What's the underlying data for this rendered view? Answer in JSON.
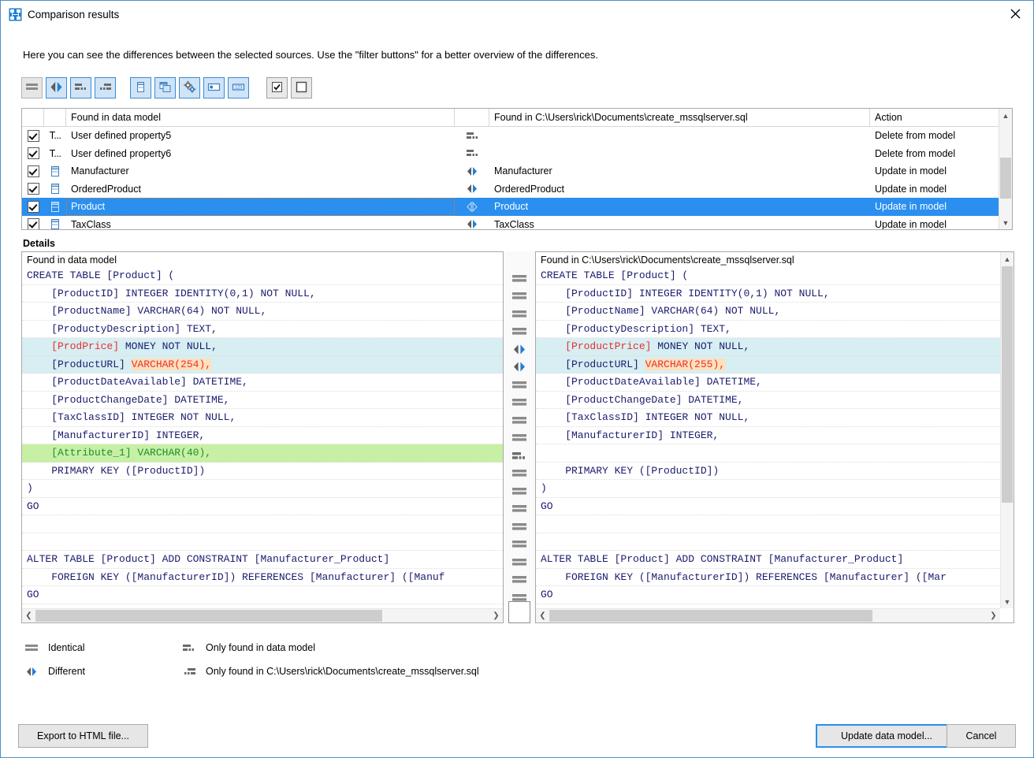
{
  "window": {
    "title": "Comparison results",
    "icon": "comparison-results-icon",
    "close_label": "✕"
  },
  "intro": {
    "text": "Here you can see the differences between the selected sources. Use the \"filter buttons\" for a better overview of the differences."
  },
  "toolbar": {
    "buttons": [
      {
        "name": "filter-identical",
        "icon": "identical-icon",
        "selected": false,
        "tooltip": "Identical"
      },
      {
        "name": "filter-different",
        "icon": "different-icon",
        "selected": true,
        "tooltip": "Different"
      },
      {
        "name": "filter-only-in-model",
        "icon": "only-in-data-model-icon",
        "selected": true,
        "tooltip": "Only found in data model"
      },
      {
        "name": "filter-only-in-file",
        "icon": "only-in-file-icon",
        "selected": true,
        "tooltip": "Only found in file"
      },
      {
        "name": "filter-tables",
        "icon": "table-icon",
        "selected": true,
        "tooltip": "Tables"
      },
      {
        "name": "filter-views",
        "icon": "views-icon",
        "selected": true,
        "tooltip": "Views"
      },
      {
        "name": "filter-procedures",
        "icon": "gears-icon",
        "selected": true,
        "tooltip": "Procedures"
      },
      {
        "name": "filter-fields",
        "icon": "field-icon",
        "selected": true,
        "tooltip": "Fields"
      },
      {
        "name": "filter-datatypes",
        "icon": "datatype-icon",
        "selected": true,
        "tooltip": "Data types"
      },
      {
        "name": "check-all",
        "icon": "checked-box-icon",
        "selected": false,
        "tooltip": "Check all"
      },
      {
        "name": "uncheck-all",
        "icon": "empty-box-icon",
        "selected": false,
        "tooltip": "Uncheck all"
      }
    ]
  },
  "grid": {
    "columns": {
      "check": "",
      "type": "",
      "left": "Found in data model",
      "middle": "",
      "right": "Found in C:\\Users\\rick\\Documents\\create_mssqlserver.sql",
      "action": "Action"
    },
    "rows": [
      {
        "checked": true,
        "type": "T...",
        "type_icon": "type-text-icon",
        "left": "User defined property5",
        "status_icon": "only-in-data-model-icon",
        "right": "",
        "action": "Delete from model",
        "selected": false
      },
      {
        "checked": true,
        "type": "T...",
        "type_icon": "type-text-icon",
        "left": "User defined property6",
        "status_icon": "only-in-data-model-icon",
        "right": "",
        "action": "Delete from model",
        "selected": false
      },
      {
        "checked": true,
        "type": "",
        "type_icon": "table-icon",
        "left": "Manufacturer",
        "status_icon": "different-icon",
        "right": "Manufacturer",
        "action": "Update in model",
        "selected": false
      },
      {
        "checked": true,
        "type": "",
        "type_icon": "table-icon",
        "left": "OrderedProduct",
        "status_icon": "different-icon",
        "right": "OrderedProduct",
        "action": "Update in model",
        "selected": false
      },
      {
        "checked": true,
        "type": "",
        "type_icon": "table-icon",
        "left": "Product",
        "status_icon": "different-icon",
        "right": "Product",
        "action": "Update in model",
        "selected": true
      },
      {
        "checked": true,
        "type": "",
        "type_icon": "table-icon",
        "left": "TaxClass",
        "status_icon": "different-icon",
        "right": "TaxClass",
        "action": "Update in model",
        "selected": false
      }
    ]
  },
  "details": {
    "label": "Details",
    "left_header": "Found in data model",
    "right_header": "Found in C:\\Users\\rick\\Documents\\create_mssqlserver.sql",
    "left_lines": [
      {
        "text": "CREATE TABLE [Product] (",
        "state": "same"
      },
      {
        "text": "    [ProductID] INTEGER IDENTITY(0,1) NOT NULL,",
        "state": "same"
      },
      {
        "text": "    [ProductName] VARCHAR(64) NOT NULL,",
        "state": "same"
      },
      {
        "text": "    [ProductyDescription] TEXT,",
        "state": "same"
      },
      {
        "text": "    [ProdPrice] MONEY NOT NULL,",
        "state": "diff",
        "hi_start": 4,
        "hi_end": 15,
        "hi_style": "red"
      },
      {
        "text": "    [ProductURL] VARCHAR(254),",
        "state": "diff",
        "hi_start": 17,
        "hi_end": 30,
        "hi_style": "red-bg"
      },
      {
        "text": "    [ProductDateAvailable] DATETIME,",
        "state": "same"
      },
      {
        "text": "    [ProductChangeDate] DATETIME,",
        "state": "same"
      },
      {
        "text": "    [TaxClassID] INTEGER NOT NULL,",
        "state": "same"
      },
      {
        "text": "    [ManufacturerID] INTEGER,",
        "state": "same"
      },
      {
        "text": "    [Attribute_1] VARCHAR(40),",
        "state": "only",
        "hi_start": 4,
        "hi_end": 30,
        "hi_style": "green"
      },
      {
        "text": "    PRIMARY KEY ([ProductID])",
        "state": "same"
      },
      {
        "text": ")",
        "state": "same"
      },
      {
        "text": "GO",
        "state": "same"
      },
      {
        "text": "",
        "state": "same"
      },
      {
        "text": "",
        "state": "same"
      },
      {
        "text": "ALTER TABLE [Product] ADD CONSTRAINT [Manufacturer_Product]",
        "state": "same"
      },
      {
        "text": "    FOREIGN KEY ([ManufacturerID]) REFERENCES [Manufacturer] ([Manuf",
        "state": "same"
      },
      {
        "text": "GO",
        "state": "same"
      }
    ],
    "right_lines": [
      {
        "text": "CREATE TABLE [Product] (",
        "state": "same"
      },
      {
        "text": "    [ProductID] INTEGER IDENTITY(0,1) NOT NULL,",
        "state": "same"
      },
      {
        "text": "    [ProductName] VARCHAR(64) NOT NULL,",
        "state": "same"
      },
      {
        "text": "    [ProductyDescription] TEXT,",
        "state": "same"
      },
      {
        "text": "    [ProductPrice] MONEY NOT NULL,",
        "state": "diff",
        "hi_start": 4,
        "hi_end": 18,
        "hi_style": "red"
      },
      {
        "text": "    [ProductURL] VARCHAR(255),",
        "state": "diff",
        "hi_start": 17,
        "hi_end": 30,
        "hi_style": "red-bg"
      },
      {
        "text": "    [ProductDateAvailable] DATETIME,",
        "state": "same"
      },
      {
        "text": "    [ProductChangeDate] DATETIME,",
        "state": "same"
      },
      {
        "text": "    [TaxClassID] INTEGER NOT NULL,",
        "state": "same"
      },
      {
        "text": "    [ManufacturerID] INTEGER,",
        "state": "same"
      },
      {
        "text": "",
        "state": "same"
      },
      {
        "text": "    PRIMARY KEY ([ProductID])",
        "state": "same"
      },
      {
        "text": ")",
        "state": "same"
      },
      {
        "text": "GO",
        "state": "same"
      },
      {
        "text": "",
        "state": "same"
      },
      {
        "text": "",
        "state": "same"
      },
      {
        "text": "ALTER TABLE [Product] ADD CONSTRAINT [Manufacturer_Product]",
        "state": "same"
      },
      {
        "text": "    FOREIGN KEY ([ManufacturerID]) REFERENCES [Manufacturer] ([Mar",
        "state": "same"
      },
      {
        "text": "GO",
        "state": "same"
      }
    ],
    "gutter_marks": [
      "identical",
      "identical",
      "identical",
      "identical",
      "different",
      "different",
      "identical",
      "identical",
      "identical",
      "identical",
      "only-in-model",
      "identical",
      "identical",
      "identical",
      "identical",
      "identical",
      "identical",
      "identical",
      "identical"
    ]
  },
  "legend": {
    "identical": "Identical",
    "different": "Different",
    "only_in_model": "Only found in data model",
    "only_in_file": "Only found in C:\\Users\\rick\\Documents\\create_mssqlserver.sql"
  },
  "footer": {
    "export": "Export to HTML file...",
    "update": "Update data model...",
    "cancel": "Cancel"
  },
  "colors": {
    "selection_blue": "#2a8fef",
    "diff_highlight": "#d7eef2",
    "only_highlight": "#c7f0a4",
    "token_red": "#e53030",
    "token_red_bg": "#ffe0bb",
    "token_green": "#1f8f2a",
    "code_blue": "#1b1b6e",
    "accent": "#3c8ad4"
  }
}
